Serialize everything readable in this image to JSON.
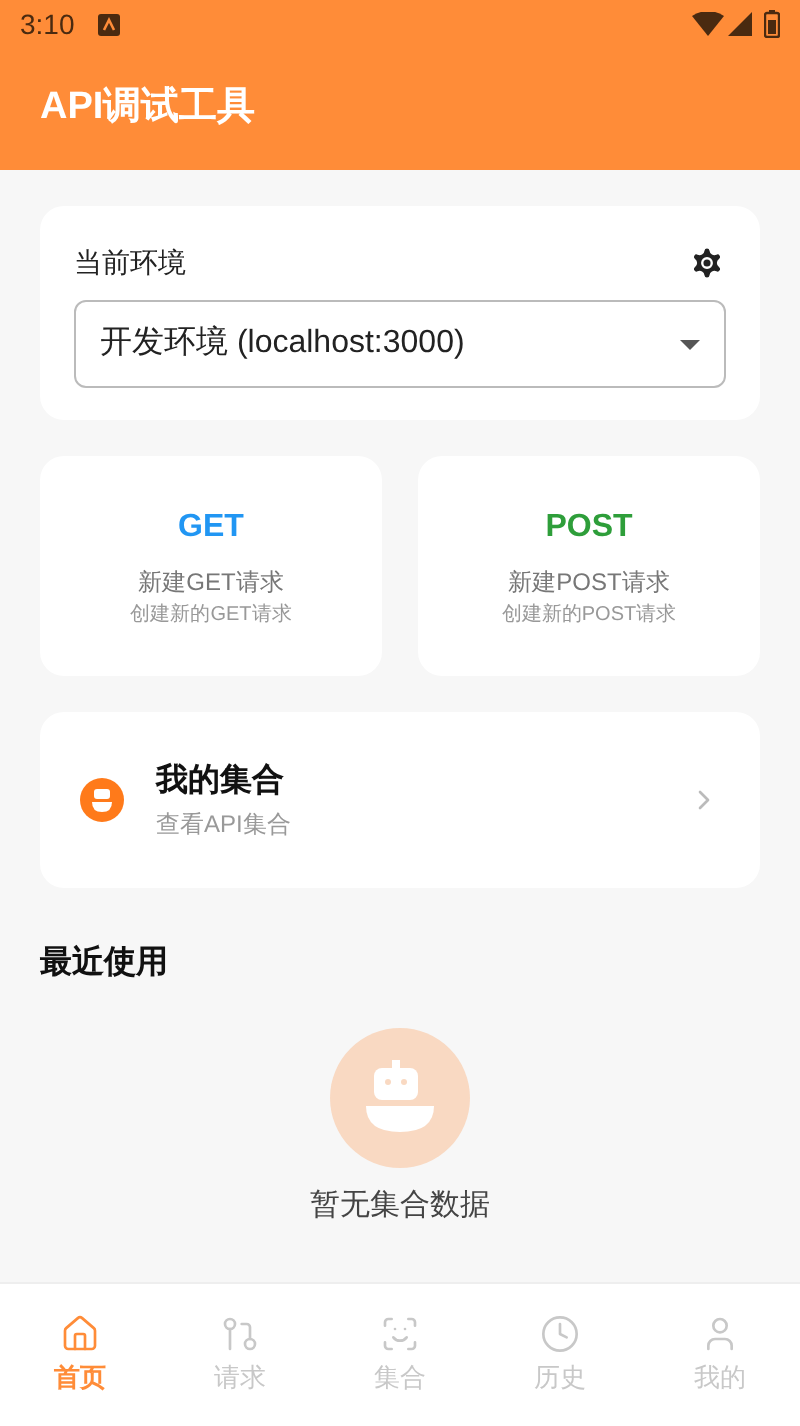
{
  "status_bar": {
    "time": "3:10"
  },
  "app_bar": {
    "title": "API调试工具"
  },
  "environment": {
    "label": "当前环境",
    "value": "开发环境 (localhost:3000)"
  },
  "methods": [
    {
      "method": "GET",
      "color": "#2196f3",
      "title": "新建GET请求",
      "subtitle": "创建新的GET请求"
    },
    {
      "method": "POST",
      "color": "#2e9e3a",
      "title": "新建POST请求",
      "subtitle": "创建新的POST请求"
    }
  ],
  "collections_card": {
    "title": "我的集合",
    "subtitle": "查看API集合"
  },
  "recent": {
    "heading": "最近使用",
    "empty_text": "暂无集合数据"
  },
  "bottom_nav": [
    {
      "label": "首页",
      "selected": true
    },
    {
      "label": "请求",
      "selected": false
    },
    {
      "label": "集合",
      "selected": false
    },
    {
      "label": "历史",
      "selected": false
    },
    {
      "label": "我的",
      "selected": false
    }
  ]
}
